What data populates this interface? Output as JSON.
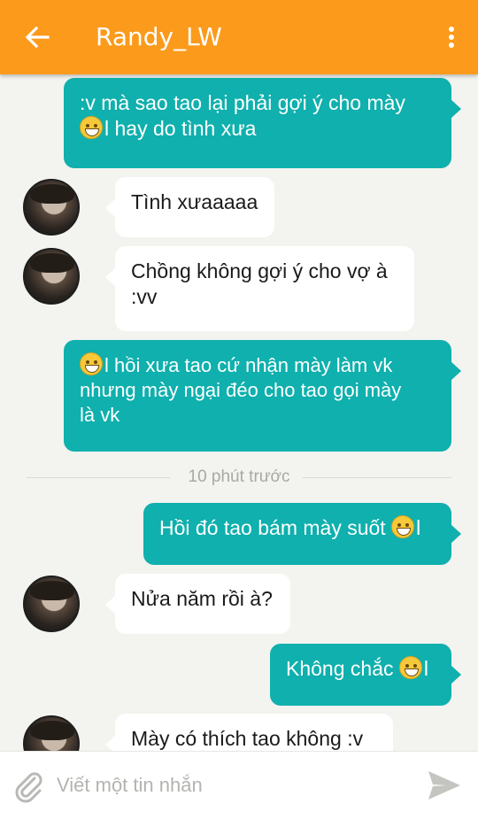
{
  "header": {
    "title": "Randy_LW",
    "back_icon": "arrow-left-icon",
    "menu_icon": "more-vertical-icon",
    "color": "#fb9a1b"
  },
  "messages": [
    {
      "dir": "out",
      "lines": [
        ":v mà sao tao lại phải gợi ý cho mày",
        "l hay do tình xưa"
      ]
    },
    {
      "dir": "in",
      "text": "Tình xưaaaaa"
    },
    {
      "dir": "in",
      "lines": [
        "Chồng không gợi ý cho vợ à",
        ":vv"
      ]
    },
    {
      "dir": "out",
      "lines": [
        "l hồi xưa tao cứ nhận mày làm vk",
        "nhưng mày ngại đéo cho tao gọi mày",
        "là vk"
      ]
    },
    {
      "dir": "out",
      "text_before": "Hồi đó tao bám mày suốt ",
      "text_after": "l"
    },
    {
      "dir": "in",
      "text": "Nửa năm rồi à?"
    },
    {
      "dir": "out",
      "text_before": "Không chắc ",
      "text_after": "l"
    },
    {
      "dir": "in",
      "text": "Mày có thích tao không :v"
    }
  ],
  "divider": {
    "label": "10 phút trước"
  },
  "composer": {
    "placeholder": "Viết một tin nhắn",
    "attach_icon": "paperclip-icon",
    "send_icon": "send-icon"
  },
  "colors": {
    "outgoing_bubble": "#0fb0ad",
    "incoming_bubble": "#ffffff",
    "background": "#f3f3ef"
  }
}
